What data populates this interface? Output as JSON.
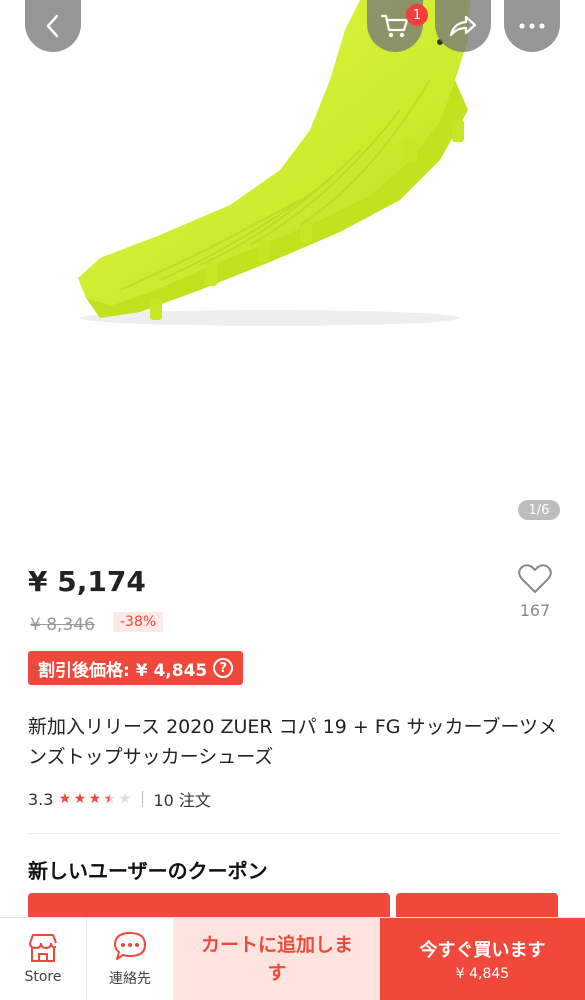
{
  "header": {
    "cart_badge": "1"
  },
  "gallery": {
    "counter": "1/6"
  },
  "product": {
    "price": "¥ 5,174",
    "original_price": "¥ 8,346",
    "discount": "-38%",
    "coupon_price": "割引後価格: ¥ 4,845",
    "title": "新加入リリース 2020 ZUER コパ 19 + FG サッカーブーツメンズトップサッカーシューズ",
    "rating": "3.3",
    "rating_value": 3.3,
    "orders": "10 注文",
    "wishlist_count": "167"
  },
  "coupons": {
    "heading": "新しいユーザーのクーポン"
  },
  "bottom_bar": {
    "store_label": "Store",
    "contact_label": "連絡先",
    "add_to_cart_label": "カートに追加します",
    "buy_now_label": "今すぐ買います",
    "buy_now_price": "¥ 4,845"
  },
  "colors": {
    "accent": "#f0493b",
    "shoe": "#d6f03a"
  }
}
